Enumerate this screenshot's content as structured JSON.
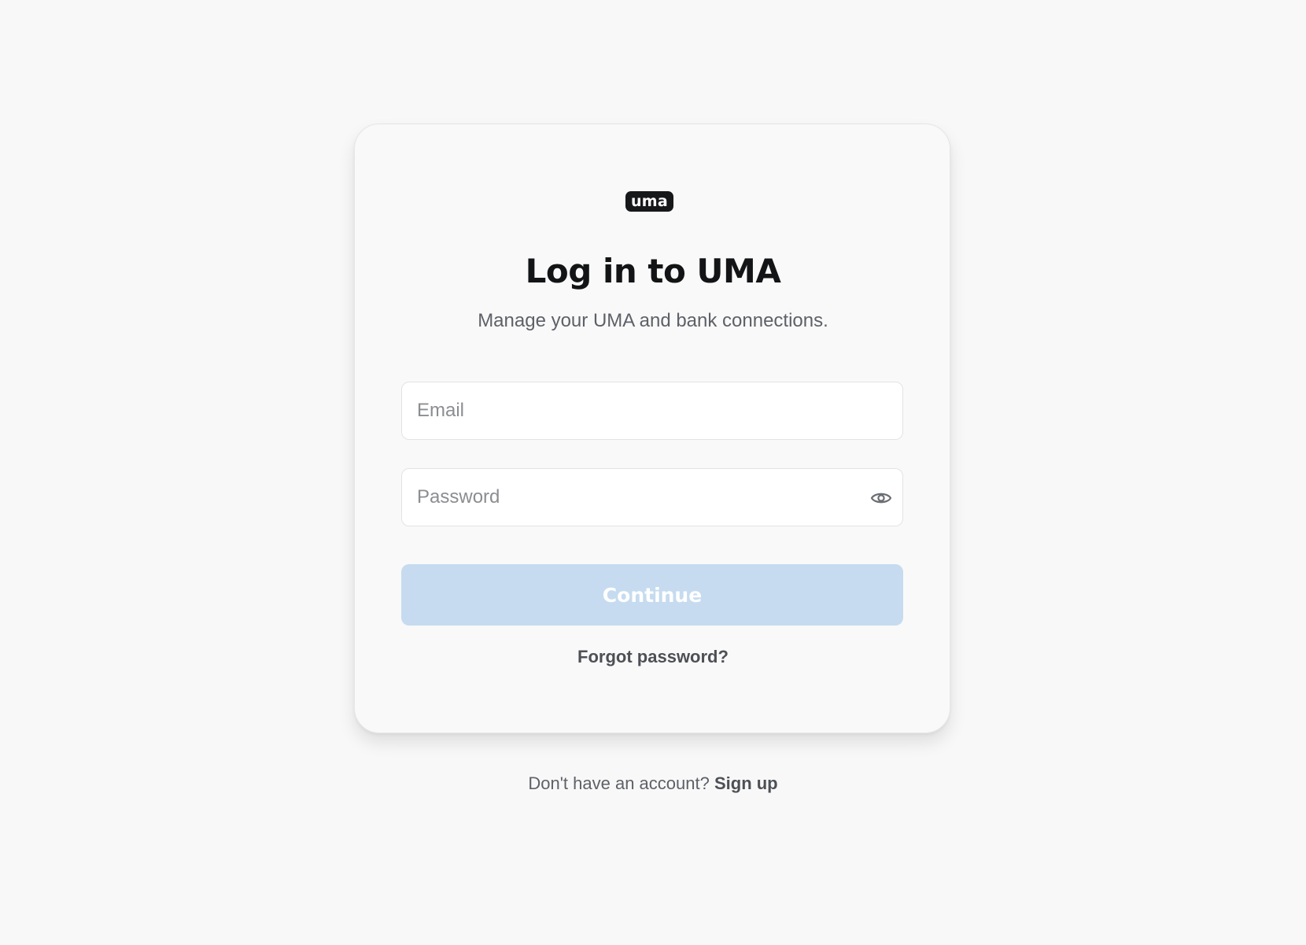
{
  "brand": {
    "logo_text": "uma",
    "logo_bg": "#16181a",
    "accent_disabled": "#c6dbef"
  },
  "login": {
    "title": "Log in to UMA",
    "subtitle": "Manage your UMA and bank connections.",
    "email": {
      "placeholder": "Email",
      "value": ""
    },
    "password": {
      "placeholder": "Password",
      "value": "",
      "toggle_icon": "eye-icon"
    },
    "continue_label": "Continue",
    "forgot_label": "Forgot password?"
  },
  "footer": {
    "prompt": "Don't have an account?",
    "signup_label": "Sign up"
  }
}
